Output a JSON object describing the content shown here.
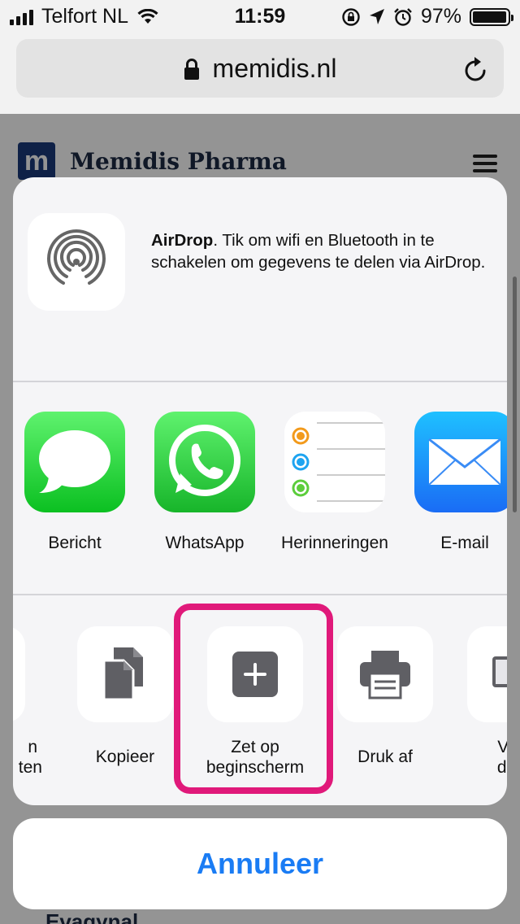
{
  "status_bar": {
    "carrier": "Telfort NL",
    "time": "11:59",
    "battery": "97%",
    "battery_level": 0.97
  },
  "browser": {
    "url": "memidis.nl",
    "lock_icon": "lock-icon",
    "reload_icon": "reload-icon"
  },
  "page": {
    "logo_letter": "m",
    "site_name": "Memidis Pharma",
    "bottom_text": "Evagynal"
  },
  "share_sheet": {
    "airdrop": {
      "title": "AirDrop",
      "description": ". Tik om wifi en Bluetooth in te schakelen om gegevens te delen via AirDrop."
    },
    "apps": [
      {
        "label": "Bericht",
        "icon": "messages-icon"
      },
      {
        "label": "WhatsApp",
        "icon": "whatsapp-icon"
      },
      {
        "label": "Herinneringen",
        "icon": "reminders-icon"
      },
      {
        "label": "E-mail",
        "icon": "mail-icon"
      }
    ],
    "actions": [
      {
        "label_line1": "n",
        "label_line2": "ten",
        "icon": "bookmark-icon"
      },
      {
        "label_line1": "Kopieer",
        "label_line2": "",
        "icon": "copy-icon"
      },
      {
        "label_line1": "Zet op",
        "label_line2": "beginscherm",
        "icon": "add-to-home-icon"
      },
      {
        "label_line1": "Druk af",
        "label_line2": "",
        "icon": "print-icon"
      },
      {
        "label_line1": "Vraa",
        "label_line2": "desk",
        "icon": "desktop-site-icon"
      }
    ],
    "highlight_color": "#e0197a",
    "cancel_label": "Annuleer",
    "cancel_color": "#1a7cf4"
  }
}
